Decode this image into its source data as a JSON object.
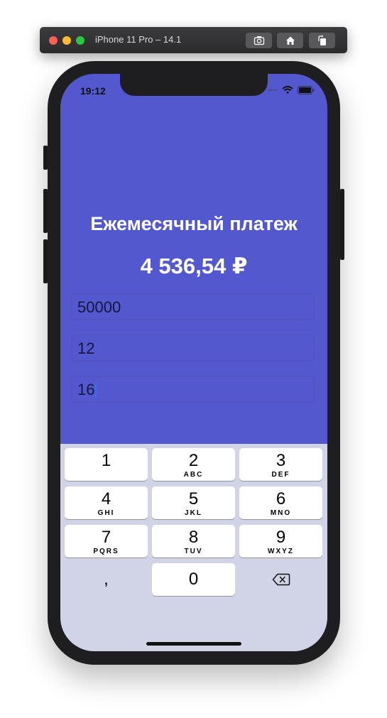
{
  "simulator": {
    "title": "iPhone 11 Pro – 14.1"
  },
  "status_bar": {
    "time": "19:12"
  },
  "main": {
    "title": "Ежемесячный платеж",
    "amount": "4 536,54 ₽",
    "fields": [
      {
        "value": "50000"
      },
      {
        "value": "12"
      },
      {
        "value": "16"
      }
    ]
  },
  "keyboard": {
    "keys": [
      {
        "num": "1",
        "letters": ""
      },
      {
        "num": "2",
        "letters": "ABC"
      },
      {
        "num": "3",
        "letters": "DEF"
      },
      {
        "num": "4",
        "letters": "GHI"
      },
      {
        "num": "5",
        "letters": "JKL"
      },
      {
        "num": "6",
        "letters": "MNO"
      },
      {
        "num": "7",
        "letters": "PQRS"
      },
      {
        "num": "8",
        "letters": "TUV"
      },
      {
        "num": "9",
        "letters": "WXYZ"
      },
      {
        "num": ",",
        "letters": ""
      },
      {
        "num": "0",
        "letters": ""
      }
    ]
  },
  "colors": {
    "background": "#5358cf",
    "keyboard": "#d1d4e6"
  }
}
